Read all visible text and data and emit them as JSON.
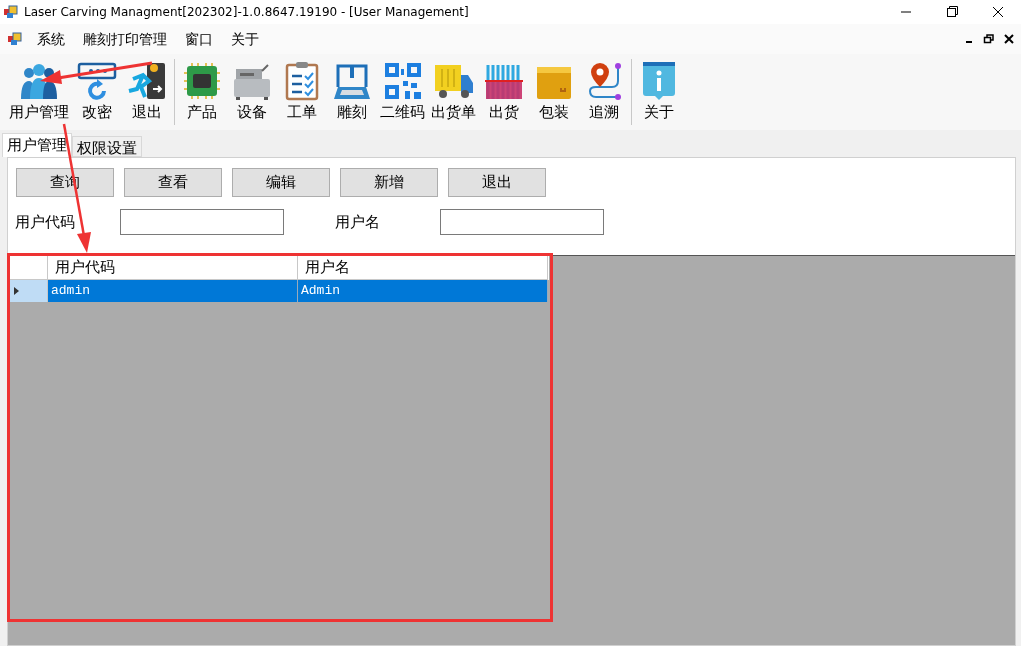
{
  "window": {
    "title": "Laser Carving Managment[202302]-1.0.8647.19190 - [User Management]"
  },
  "menu": [
    "系统",
    "雕刻打印管理",
    "窗口",
    "关于"
  ],
  "toolbar": {
    "groups": [
      [
        {
          "label": "用户管理",
          "kind": "users"
        },
        {
          "label": "改密",
          "kind": "password"
        },
        {
          "label": "退出",
          "kind": "exit"
        }
      ],
      [
        {
          "label": "产品",
          "kind": "chip"
        },
        {
          "label": "设备",
          "kind": "printer"
        },
        {
          "label": "工单",
          "kind": "clipboard"
        },
        {
          "label": "雕刻",
          "kind": "engraver"
        },
        {
          "label": "二维码",
          "kind": "qrcode"
        },
        {
          "label": "出货单",
          "kind": "truck"
        },
        {
          "label": "出货",
          "kind": "barcode"
        },
        {
          "label": "包装",
          "kind": "box"
        },
        {
          "label": "追溯",
          "kind": "route"
        }
      ],
      [
        {
          "label": "关于",
          "kind": "info"
        }
      ]
    ]
  },
  "tabs": [
    {
      "label": "用户管理",
      "selected": true
    },
    {
      "label": "权限设置",
      "selected": false
    }
  ],
  "buttons": [
    "查询",
    "查看",
    "编辑",
    "新增",
    "退出"
  ],
  "filters": [
    {
      "label": "用户代码"
    },
    {
      "label": "用户名"
    }
  ],
  "table": {
    "columns": [
      "用户代码",
      "用户名"
    ],
    "rows": [
      {
        "cells": [
          "admin",
          "Admin"
        ],
        "selected": true
      }
    ]
  }
}
